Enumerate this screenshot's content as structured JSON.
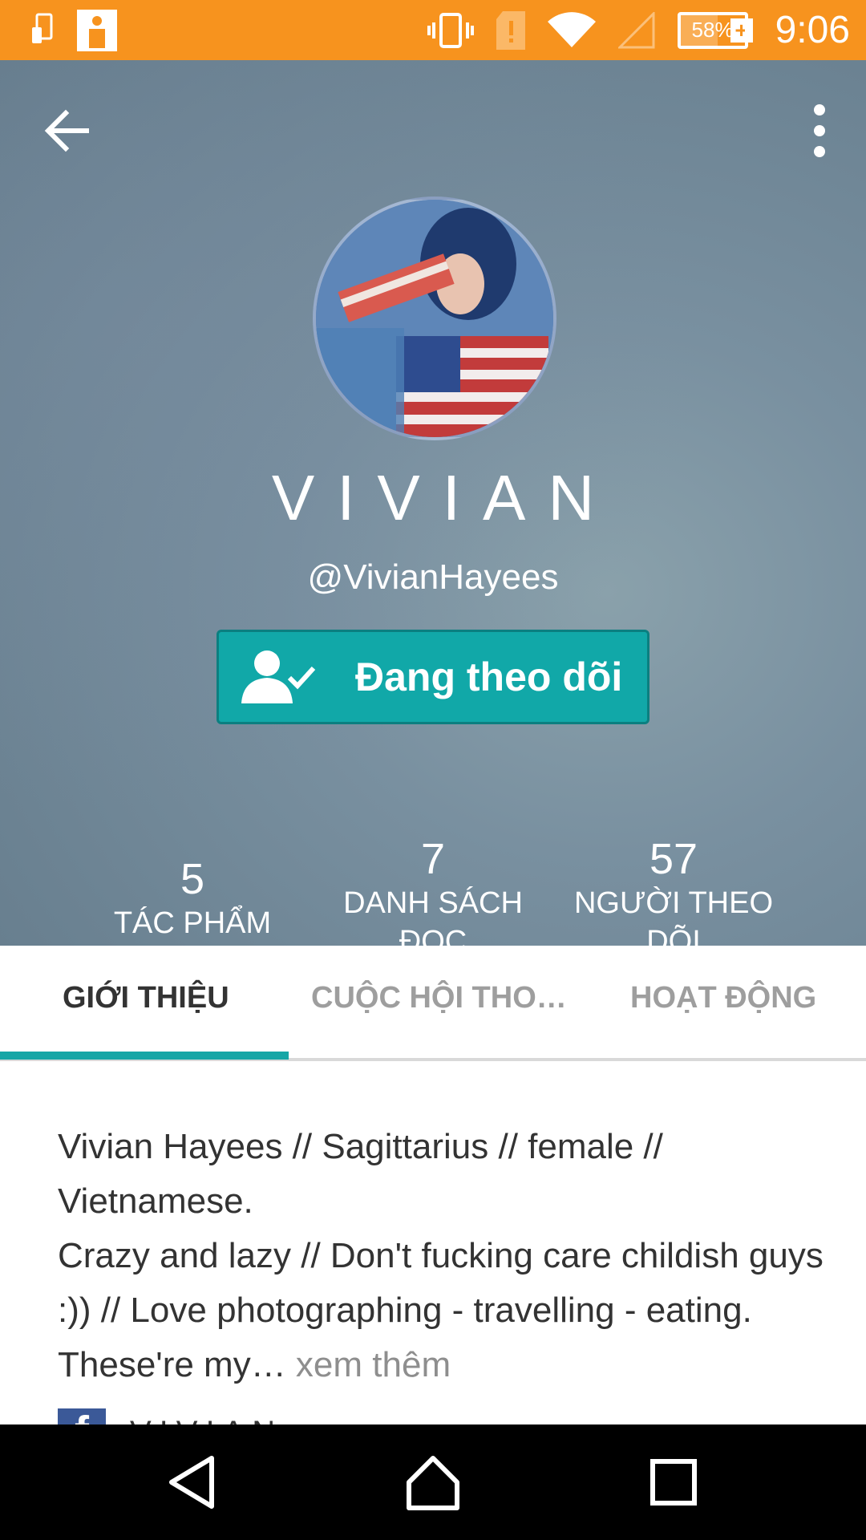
{
  "status_bar": {
    "time": "9:06",
    "battery": "58%",
    "battery_level": 0.58,
    "icons": [
      "phone-transfer-icon",
      "app-notification-icon",
      "vibrate-icon",
      "sim-alert-icon",
      "wifi-icon",
      "cellular-signal-icon",
      "battery-charging-icon"
    ]
  },
  "header": {
    "back_icon": "arrow-left-icon",
    "more_icon": "more-vertical-icon"
  },
  "profile": {
    "display_name": "VIVIAN",
    "username": "@VivianHayees",
    "follow_button": "Đang theo dõi",
    "follow_icon": "user-check-icon"
  },
  "stats": [
    {
      "value": "5",
      "label": "TÁC PHẨM"
    },
    {
      "value": "7",
      "label": "DANH SÁCH ĐỌC"
    },
    {
      "value": "57",
      "label": "NGƯỜI THEO DÕI"
    }
  ],
  "tabs": [
    {
      "label": "GIỚI THIỆU",
      "active": true
    },
    {
      "label": "CUỘC HỘI THO…",
      "active": false
    },
    {
      "label": "HOẠT ĐỘNG",
      "active": false
    }
  ],
  "bio": {
    "line1": "Vivian Hayees // Sagittarius // female // Vietnamese.",
    "line2": "Crazy and lazy // Don't fucking care childish guys :)) // Love photographing - travelling - eating. These're my…",
    "more_link": " xem thêm"
  },
  "social": {
    "icon": "facebook-icon",
    "name": "VIVIAN"
  },
  "nav": [
    "back-nav-icon",
    "home-nav-icon",
    "recents-nav-icon"
  ],
  "colors": {
    "status_bar": "#f7931e",
    "accent": "#16a6a6",
    "follow_button": "#11a8a8"
  }
}
